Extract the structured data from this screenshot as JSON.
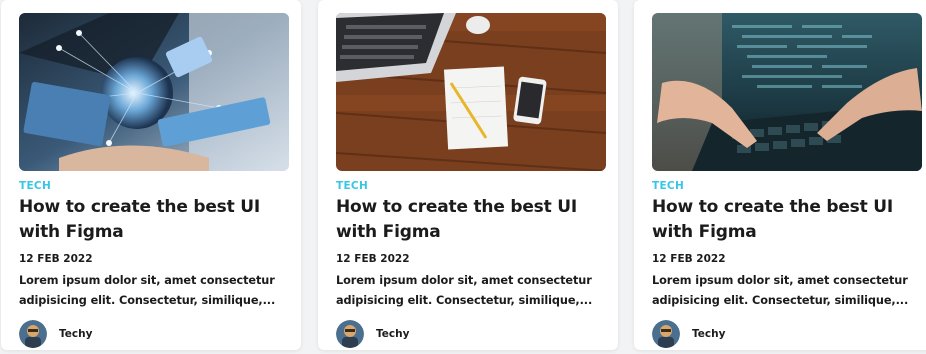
{
  "posts": [
    {
      "category": "TECH",
      "title": "How to create the best UI with Figma",
      "date": "12 FEB 2022",
      "excerpt": "Lorem ipsum dolor sit, amet consectetur adipisicing elit. Consectetur, similique,...",
      "author": "Techy",
      "image": "network-hands-image"
    },
    {
      "category": "TECH",
      "title": "How to create the best UI with Figma",
      "date": "12 FEB 2022",
      "excerpt": "Lorem ipsum dolor sit, amet consectetur adipisicing elit. Consectetur, similique,...",
      "author": "Techy",
      "image": "laptop-desk-image"
    },
    {
      "category": "TECH",
      "title": "How to create the best UI with Figma",
      "date": "12 FEB 2022",
      "excerpt": "Lorem ipsum dolor sit, amet consectetur adipisicing elit. Consectetur, similique,...",
      "author": "Techy",
      "image": "keyboard-code-image"
    }
  ],
  "colors": {
    "category": "#38c6e6",
    "text": "#1b1b1b",
    "card": "#ffffff",
    "background": "#f2f3f5"
  }
}
